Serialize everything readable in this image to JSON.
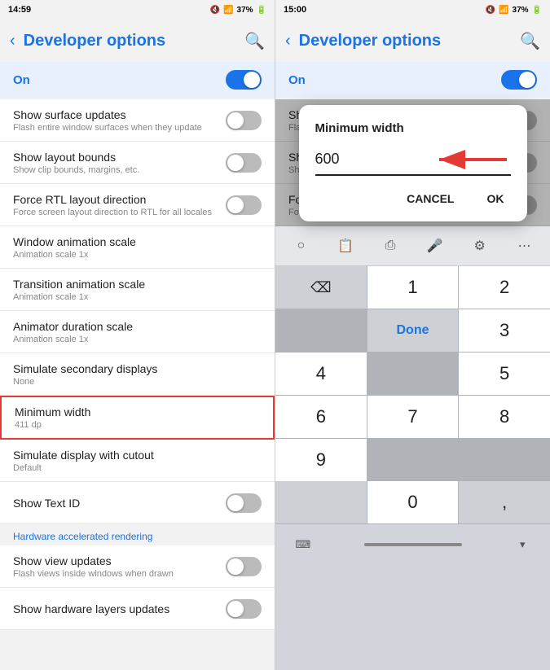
{
  "left_panel": {
    "status_time": "14:59",
    "status_icons": "🔇 📶 37%",
    "header": {
      "back": "‹",
      "title": "Developer options",
      "search_icon": "🔍"
    },
    "on_section": {
      "label": "On",
      "toggle_state": "on"
    },
    "settings": [
      {
        "title": "Show surface updates",
        "subtitle": "Flash entire window surfaces when they update",
        "has_toggle": true,
        "toggle_state": "off"
      },
      {
        "title": "Show layout bounds",
        "subtitle": "Show clip bounds, margins, etc.",
        "has_toggle": true,
        "toggle_state": "off"
      },
      {
        "title": "Force RTL layout direction",
        "subtitle": "Force screen layout direction to RTL for all locales",
        "has_toggle": true,
        "toggle_state": "off"
      },
      {
        "title": "Window animation scale",
        "subtitle": "Animation scale 1x",
        "has_toggle": false
      },
      {
        "title": "Transition animation scale",
        "subtitle": "Animation scale 1x",
        "has_toggle": false
      },
      {
        "title": "Animator duration scale",
        "subtitle": "Animation scale 1x",
        "has_toggle": false
      },
      {
        "title": "Simulate secondary displays",
        "subtitle": "None",
        "has_toggle": false
      },
      {
        "title": "Minimum width",
        "subtitle": "411 dp",
        "has_toggle": false,
        "highlighted": true
      },
      {
        "title": "Simulate display with cutout",
        "subtitle": "Default",
        "has_toggle": false
      },
      {
        "title": "Show Text ID",
        "subtitle": "",
        "has_toggle": true,
        "toggle_state": "off"
      }
    ],
    "section_label": "Hardware accelerated rendering",
    "extra_settings": [
      {
        "title": "Show view updates",
        "subtitle": "Flash views inside windows when drawn",
        "has_toggle": true,
        "toggle_state": "off"
      },
      {
        "title": "Show hardware layers updates",
        "subtitle": "",
        "has_toggle": true,
        "toggle_state": "off"
      }
    ]
  },
  "right_panel": {
    "status_time": "15:00",
    "status_icons": "🔇 📶 37%",
    "header": {
      "back": "‹",
      "title": "Developer options",
      "search_icon": "🔍"
    },
    "on_section": {
      "label": "On",
      "toggle_state": "on"
    },
    "settings": [
      {
        "title": "Show surface updates",
        "subtitle": "Flash entire window surfaces when they update",
        "has_toggle": true,
        "toggle_state": "off"
      },
      {
        "title": "Show layout bounds",
        "subtitle": "Show clip bounds, margins, etc.",
        "has_toggle": true,
        "toggle_state": "off"
      },
      {
        "title": "Force RTL layout direction",
        "subtitle": "Force screen layout direction to RTL for all locales",
        "has_toggle": true,
        "toggle_state": "off"
      }
    ],
    "dialog": {
      "title": "Minimum width",
      "value": "600",
      "cancel_label": "Cancel",
      "ok_label": "OK"
    },
    "keyboard": {
      "keys": [
        "1",
        "2",
        "3",
        "4",
        "5",
        "6",
        "7",
        "8",
        "9",
        "0"
      ],
      "done_label": "Done",
      "special_keys": [
        "←",
        "⌨",
        "↓"
      ]
    }
  }
}
